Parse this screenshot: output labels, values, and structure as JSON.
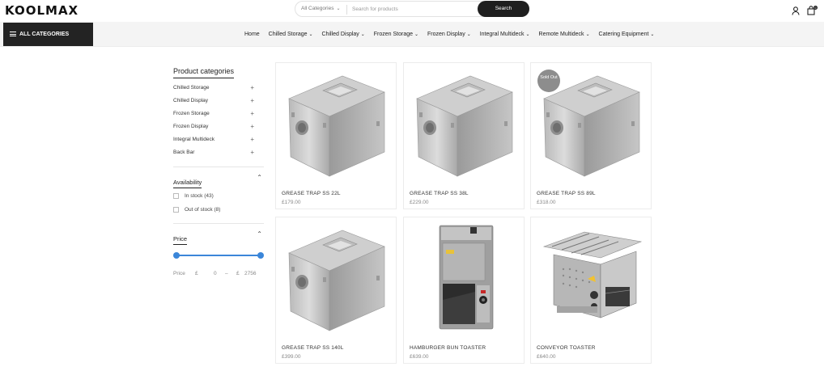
{
  "brand": {
    "logo": "KOOLMAX"
  },
  "search": {
    "category": "All Categories",
    "placeholder": "Search for products",
    "button": "Search"
  },
  "header_icons": {
    "account": "user-icon",
    "cart": "bag-icon",
    "cart_count": "0"
  },
  "nav": {
    "all_categories": "ALL CATEGORIES",
    "items": [
      "Home",
      "Chilled Storage",
      "Chilled Display",
      "Frozen Storage",
      "Frozen Display",
      "Integral Multideck",
      "Remote Multideck",
      "Catering Equipment"
    ]
  },
  "sidebar": {
    "title": "Product categories",
    "categories": [
      "Chilled Storage",
      "Chilled Display",
      "Frozen Storage",
      "Frozen Display",
      "Integral Multideck",
      "Back Bar"
    ],
    "availability": {
      "title": "Availability",
      "options": [
        "In stock (43)",
        "Out of stock (8)"
      ]
    },
    "price": {
      "title": "Price",
      "label": "Price",
      "currency": "£",
      "min": "0",
      "dash": "–",
      "max": "2756"
    }
  },
  "products": [
    {
      "name": "GREASE TRAP SS 22L",
      "price": "£179.00",
      "badge": "",
      "kind": "trap"
    },
    {
      "name": "GREASE TRAP SS 38L",
      "price": "£229.00",
      "badge": "",
      "kind": "trap"
    },
    {
      "name": "GREASE TRAP SS 89L",
      "price": "£318.00",
      "badge": "Sold Out",
      "kind": "trap"
    },
    {
      "name": "GREASE TRAP SS 140L",
      "price": "£399.00",
      "badge": "",
      "kind": "trap"
    },
    {
      "name": "HAMBURGER BUN TOASTER",
      "price": "£639.00",
      "badge": "",
      "kind": "bun"
    },
    {
      "name": "CONVEYOR TOASTER",
      "price": "£640.00",
      "badge": "",
      "kind": "conveyor"
    }
  ]
}
